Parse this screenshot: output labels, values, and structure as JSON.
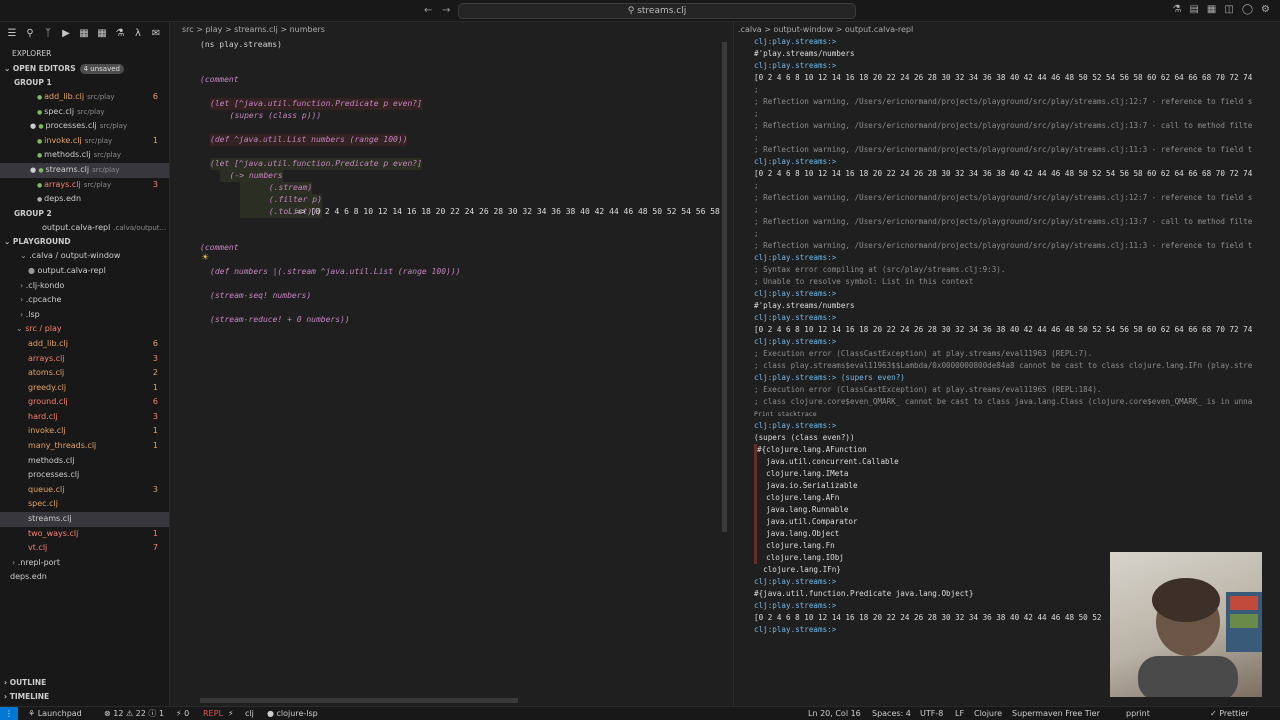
{
  "title": {
    "search": "streams.clj"
  },
  "sidebar": {
    "explorer_label": "EXPLORER",
    "open_editors": {
      "label": "OPEN EDITORS",
      "badge": "4 unsaved"
    },
    "group1": {
      "label": "GROUP 1",
      "items": [
        {
          "name": "add_lib.clj",
          "path": "src/play",
          "count": "6",
          "color": "orange"
        },
        {
          "name": "spec.clj",
          "path": "src/play",
          "count": "",
          "color": "white"
        },
        {
          "name": "processes.clj",
          "path": "src/play",
          "count": "",
          "color": "white"
        },
        {
          "name": "invoke.clj",
          "path": "src/play",
          "count": "1",
          "color": "orange"
        },
        {
          "name": "methods.clj",
          "path": "src/play",
          "count": "",
          "color": "white"
        },
        {
          "name": "streams.clj",
          "path": "src/play",
          "count": "",
          "color": "white"
        },
        {
          "name": "arrays.clj",
          "path": "src/play",
          "count": "3",
          "color": "red"
        },
        {
          "name": "deps.edn",
          "path": "",
          "count": "",
          "color": "white"
        }
      ]
    },
    "group2": {
      "label": "GROUP 2",
      "items": [
        {
          "name": "output.calva-repl",
          "path": ".calva/output...",
          "count": "",
          "color": "white"
        }
      ]
    },
    "playground": {
      "label": "PLAYGROUND",
      "items": [
        {
          "name": ".calva / output-window",
          "count": ""
        },
        {
          "name": "output.calva-repl",
          "count": ""
        },
        {
          "name": ".clj-kondo",
          "count": ""
        },
        {
          "name": ".cpcache",
          "count": ""
        },
        {
          "name": ".lsp",
          "count": ""
        },
        {
          "name": "src / play",
          "count": ""
        }
      ],
      "files": [
        {
          "name": "add_lib.clj",
          "count": "6",
          "color": "orange"
        },
        {
          "name": "arrays.clj",
          "count": "3",
          "color": "red"
        },
        {
          "name": "atoms.clj",
          "count": "2",
          "color": "orange"
        },
        {
          "name": "greedy.clj",
          "count": "1",
          "color": "orange"
        },
        {
          "name": "ground.clj",
          "count": "6",
          "color": "red"
        },
        {
          "name": "hard.clj",
          "count": "3",
          "color": "red"
        },
        {
          "name": "invoke.clj",
          "count": "1",
          "color": "orange"
        },
        {
          "name": "many_threads.clj",
          "count": "1",
          "color": "orange"
        },
        {
          "name": "methods.clj",
          "count": "",
          "color": "white"
        },
        {
          "name": "processes.clj",
          "count": "",
          "color": "white"
        },
        {
          "name": "queue.clj",
          "count": "3",
          "color": "orange"
        },
        {
          "name": "spec.clj",
          "count": "",
          "color": "orange"
        },
        {
          "name": "streams.clj",
          "count": "",
          "color": "white"
        },
        {
          "name": "two_ways.clj",
          "count": "1",
          "color": "red"
        },
        {
          "name": "vt.clj",
          "count": "7",
          "color": "red"
        }
      ],
      "tail": [
        {
          "name": ".nrepl-port"
        },
        {
          "name": "deps.edn"
        }
      ]
    },
    "outline": "OUTLINE",
    "timeline": "TIMELINE"
  },
  "editor": {
    "breadcrumb": "src  >  play  >  streams.clj  >  numbers",
    "lines": [
      "(ns play.streams)",
      "(comment",
      "(let [^java.util.function.Predicate p even?]",
      "  (supers (class p)))",
      "(def ^java.util.List numbers (range 100))",
      "(let [^java.util.function.Predicate p even?]",
      "  (-> numbers",
      "      (.stream)",
      "      (.filter p)",
      "      (.toList)))",
      "=> [0 2 4 6 8 10 12 14 16 18 20 22 24 26 28 30 32 34 36 38 40 42 44 46 48 50 52 54 56 58",
      "(comment",
      "(def numbers |(.stream ^java.util.List (range 100)))",
      "(stream-seq! numbers)",
      "(stream-reduce! + 0 numbers))"
    ]
  },
  "repl": {
    "breadcrumb": ".calva  >  output-window  >  output.calva-repl",
    "lines": [
      "clj:play.streams:>",
      "#'play.streams/numbers",
      "clj:play.streams:>",
      "[0 2 4 6 8 10 12 14 16 18 20 22 24 26 28 30 32 34 36 38 40 42 44 46 48 50 52 54 56 58 60 62 64 66 68 70 72 74",
      ";",
      "; Reflection warning, /Users/ericnormand/projects/playground/src/play/streams.clj:12:7 - reference to field s",
      ";",
      "; Reflection warning, /Users/ericnormand/projects/playground/src/play/streams.clj:13:7 - call to method filte",
      ";",
      "; Reflection warning, /Users/ericnormand/projects/playground/src/play/streams.clj:11:3 - reference to field t",
      "clj:play.streams:>",
      "[0 2 4 6 8 10 12 14 16 18 20 22 24 26 28 30 32 34 36 38 40 42 44 46 48 50 52 54 56 58 60 62 64 66 68 70 72 74",
      ";",
      "; Reflection warning, /Users/ericnormand/projects/playground/src/play/streams.clj:12:7 - reference to field s",
      ";",
      "; Reflection warning, /Users/ericnormand/projects/playground/src/play/streams.clj:13:7 - call to method filte",
      ";",
      "; Reflection warning, /Users/ericnormand/projects/playground/src/play/streams.clj:11:3 - reference to field t",
      "clj:play.streams:>",
      "; Syntax error compiling at (src/play/streams.clj:9:3).",
      "; Unable to resolve symbol: List in this context",
      "clj:play.streams:>",
      "#'play.streams/numbers",
      "clj:play.streams:>",
      "[0 2 4 6 8 10 12 14 16 18 20 22 24 26 28 30 32 34 36 38 40 42 44 46 48 50 52 54 56 58 60 62 64 66 68 70 72 74",
      "clj:play.streams:>",
      "; Execution error (ClassCastException) at play.streams/eval11963 (REPL:7).",
      "; class play.streams$eval11963$$Lambda/0x0000000800de84a8 cannot be cast to class clojure.lang.IFn (play.stre",
      "clj:play.streams:> (supers even?)",
      "; Execution error (ClassCastException) at play.streams/eval11965 (REPL:184).",
      "; class clojure.core$even_QMARK_ cannot be cast to class java.lang.Class (clojure.core$even_QMARK_ is in unna",
      "Print stacktrace",
      "clj:play.streams:>",
      "(supers (class even?))",
      "#{clojure.lang.AFunction",
      "  java.util.concurrent.Callable",
      "  clojure.lang.IMeta",
      "  java.io.Serializable",
      "  clojure.lang.AFn",
      "  java.lang.Runnable",
      "  java.util.Comparator",
      "  java.lang.Object",
      "  clojure.lang.Fn",
      "  clojure.lang.IObj",
      "  clojure.lang.IFn}",
      "clj:play.streams:>",
      "#{java.util.function.Predicate java.lang.Object}",
      "clj:play.streams:>",
      "[0 2 4 6 8 10 12 14 16 18 20 22 24 26 28 30 32 34 36 38 40 42 44 46 48 50 52 54 56 58 60 62 64 66 68 70 72 74",
      "clj:play.streams:>"
    ]
  },
  "status": {
    "launchpad": "Launchpad",
    "problems": "⊗ 12 ⚠ 22 ⓘ 1",
    "ports": "⚡ 0",
    "repl": "REPL",
    "repl_flag": "⚡",
    "clj": "clj",
    "lsp": "● clojure-lsp",
    "position": "Ln 20, Col 16",
    "spaces": "Spaces: 4",
    "encoding": "UTF-8",
    "eol": "LF",
    "lang": "Clojure",
    "supermaven": "Supermaven Free Tier",
    "pprint": "pprint",
    "prettier": "✓ Prettier"
  }
}
